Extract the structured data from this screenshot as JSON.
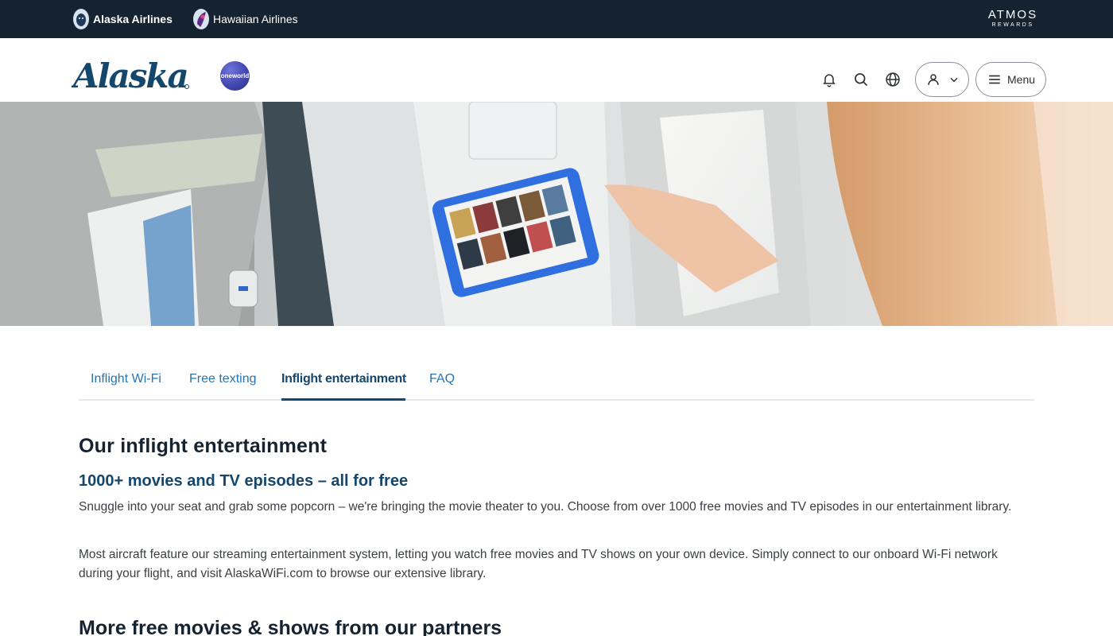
{
  "topbar": {
    "brands": [
      {
        "label": "Alaska Airlines",
        "icon": "alaska-eskimo-icon"
      },
      {
        "label": "Hawaiian Airlines",
        "icon": "hawaiian-pualani-icon"
      }
    ],
    "atmos": {
      "line1": "ATMOS",
      "line2": "REWARDS"
    }
  },
  "header": {
    "logo_text": "Alaska",
    "oneworld_text": "oneworld",
    "icons": [
      "bell-icon",
      "search-icon",
      "globe-icon"
    ],
    "menu_label": "Menu"
  },
  "hero": {
    "image": "passenger-watching-tablet-on-seatback"
  },
  "tabs": [
    {
      "label": "Inflight Wi-Fi"
    },
    {
      "label": "Free texting"
    },
    {
      "label": "Inflight entertainment",
      "active": true
    },
    {
      "label": "FAQ"
    }
  ],
  "content": {
    "title": "Our inflight entertainment",
    "subtitle": "1000+ movies and TV episodes – all for free",
    "paragraph1": "Snuggle into your seat and grab some popcorn – we're bringing the movie theater to you. Choose from over 1000 free movies and TV episodes in our entertainment library.",
    "paragraph2": "Most aircraft feature our streaming entertainment system, letting you watch free movies and TV shows on your own device. Simply connect to our onboard Wi-Fi network during your flight, and visit AlaskaWiFi.com to browse our extensive library.",
    "next_heading": "More free movies & shows from our partners"
  },
  "colors": {
    "navy": "#15222f",
    "link": "#2774ae",
    "active_tab": "#15466b"
  }
}
